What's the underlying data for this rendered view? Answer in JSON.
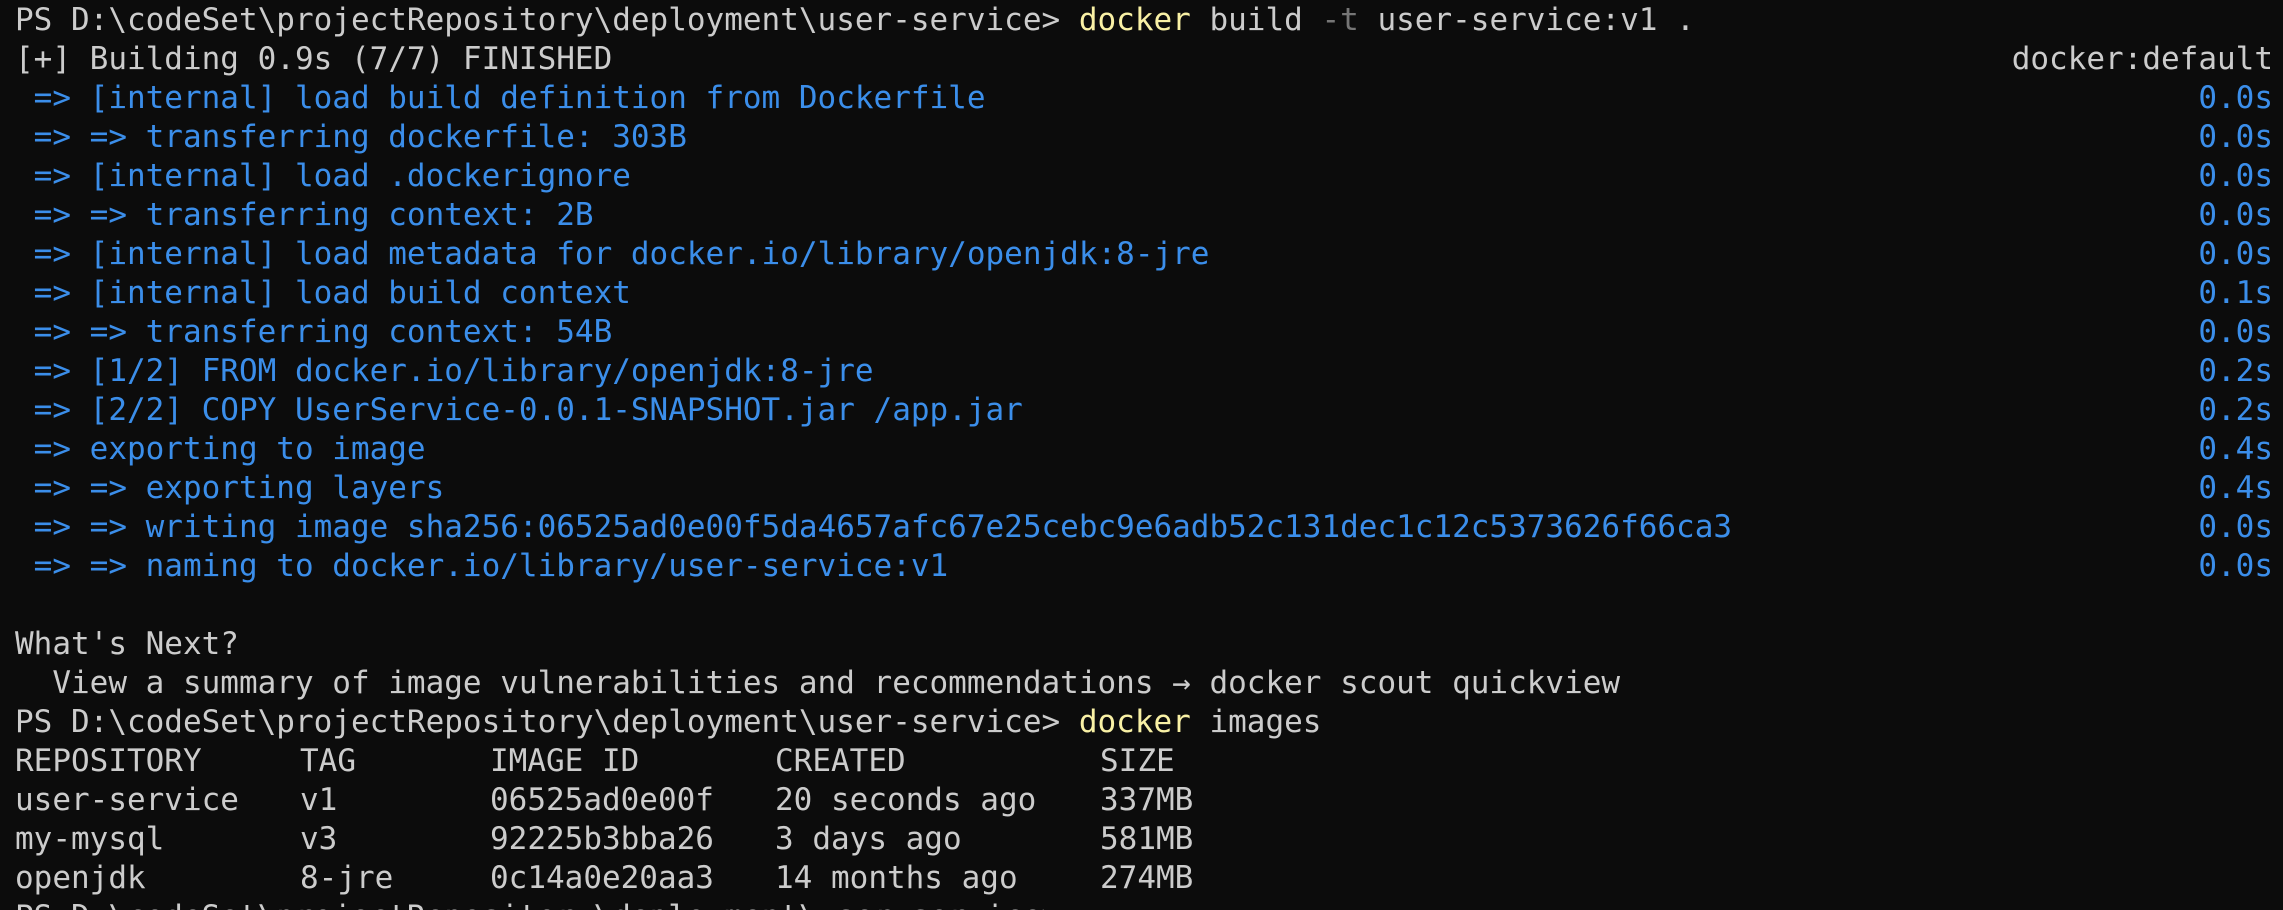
{
  "prompt1": {
    "path": "PS D:\\codeSet\\projectRepository\\deployment\\user-service> ",
    "cmd": "docker",
    "args_a": " build ",
    "flag": "-t",
    "args_b": " user-service:v1 ."
  },
  "build_header": {
    "status": "[+] Building 0.9s (7/7) FINISHED",
    "builder": "docker:default"
  },
  "build_steps": [
    {
      "text": " => [internal] load build definition from Dockerfile",
      "time": "0.0s"
    },
    {
      "text": " => => transferring dockerfile: 303B",
      "time": "0.0s"
    },
    {
      "text": " => [internal] load .dockerignore",
      "time": "0.0s"
    },
    {
      "text": " => => transferring context: 2B",
      "time": "0.0s"
    },
    {
      "text": " => [internal] load metadata for docker.io/library/openjdk:8-jre",
      "time": "0.0s"
    },
    {
      "text": " => [internal] load build context",
      "time": "0.1s"
    },
    {
      "text": " => => transferring context: 54B",
      "time": "0.0s"
    },
    {
      "text": " => [1/2] FROM docker.io/library/openjdk:8-jre",
      "time": "0.2s"
    },
    {
      "text": " => [2/2] COPY UserService-0.0.1-SNAPSHOT.jar /app.jar",
      "time": "0.2s"
    },
    {
      "text": " => exporting to image",
      "time": "0.4s"
    },
    {
      "text": " => => exporting layers",
      "time": "0.4s"
    },
    {
      "text": " => => writing image sha256:06525ad0e00f5da4657afc67e25cebc9e6adb52c131dec1c12c5373626f66ca3",
      "time": "0.0s"
    },
    {
      "text": " => => naming to docker.io/library/user-service:v1",
      "time": "0.0s"
    }
  ],
  "whats_next": {
    "title": "What's Next?",
    "hint": "  View a summary of image vulnerabilities and recommendations → docker scout quickview"
  },
  "prompt2": {
    "path": "PS D:\\codeSet\\projectRepository\\deployment\\user-service> ",
    "cmd": "docker",
    "args": " images"
  },
  "images_table": {
    "headers": [
      "REPOSITORY",
      "TAG",
      "IMAGE ID",
      "CREATED",
      "SIZE"
    ],
    "rows": [
      [
        "user-service",
        "v1",
        "06525ad0e00f",
        "20 seconds ago",
        "337MB"
      ],
      [
        "my-mysql",
        "v3",
        "92225b3bba26",
        "3 days ago",
        "581MB"
      ],
      [
        "openjdk",
        "8-jre",
        "0c14a0e20aa3",
        "14 months ago",
        "274MB"
      ]
    ]
  },
  "prompt3": {
    "path": "PS D:\\codeSet\\projectRepository\\deployment\\user-service> "
  },
  "colors": {
    "background": "#0c0c0c",
    "text": "#cccccc",
    "blue": "#3b8eea",
    "yellow": "#f9f1a5",
    "dim": "#767676"
  }
}
